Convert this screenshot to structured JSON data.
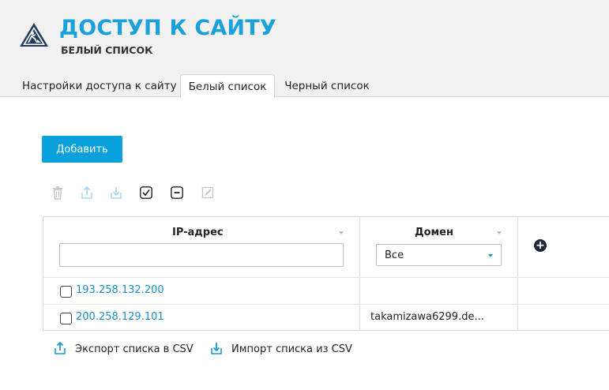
{
  "header": {
    "title": "ДОСТУП К САЙТУ",
    "subtitle": "БЕЛЫЙ СПИСОК",
    "accent_color": "#1aa0db",
    "logo_icon": "road-work-icon"
  },
  "tabs": [
    {
      "label": "Настройки доступа к сайту",
      "active": false
    },
    {
      "label": "Белый список",
      "active": true
    },
    {
      "label": "Черный список",
      "active": false
    }
  ],
  "toolbar": {
    "add_label": "Добавить",
    "icons": [
      "trash-icon",
      "export-icon",
      "import-icon",
      "check-all-icon",
      "uncheck-all-icon",
      "edit-icon"
    ]
  },
  "table": {
    "columns": [
      {
        "header": "IP-адрес",
        "filter_value": ""
      },
      {
        "header": "Домен",
        "filter_value": "Все"
      }
    ],
    "rows": [
      {
        "ip": "193.258.132.200",
        "domain": ""
      },
      {
        "ip": "200.258.129.101",
        "domain": "takamizawa6299.de..."
      }
    ]
  },
  "footer": {
    "export_label": "Экспорт списка в CSV",
    "import_label": "Импорт списка из CSV"
  }
}
